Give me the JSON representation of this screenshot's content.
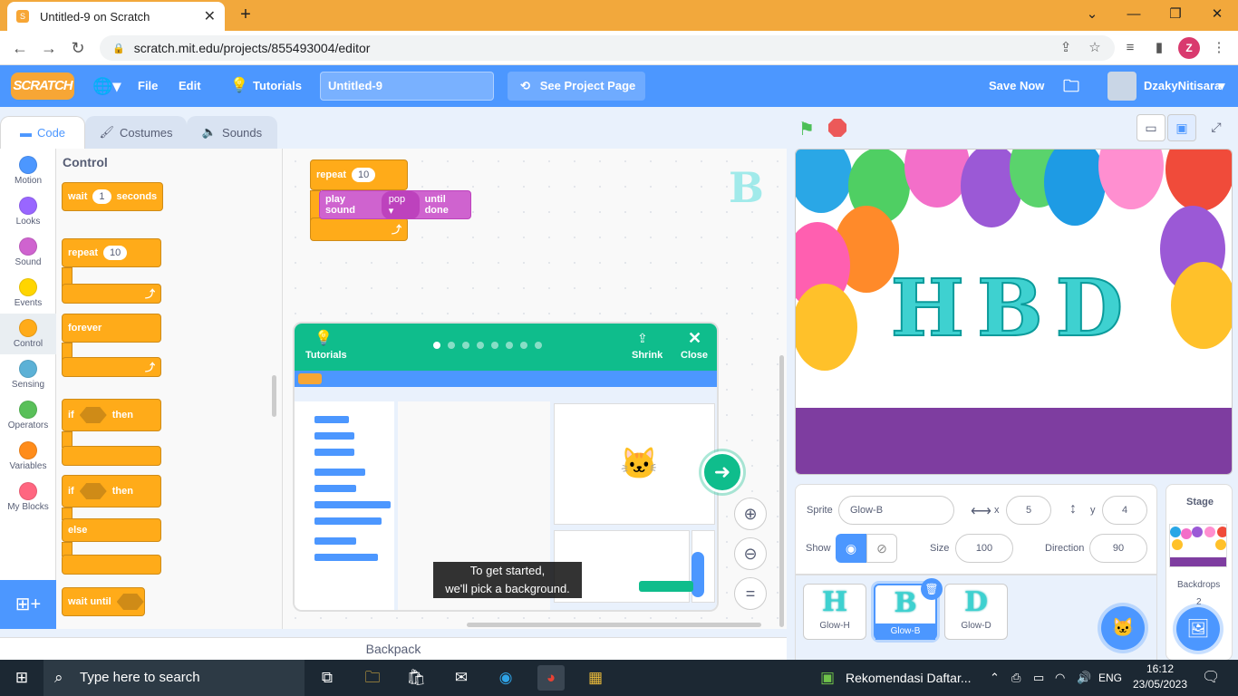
{
  "browser": {
    "tab_title": "Untitled-9 on Scratch",
    "url": "scratch.mit.edu/projects/855493004/editor",
    "profile_initial": "Z"
  },
  "menu": {
    "logo": "SCRATCH",
    "file": "File",
    "edit": "Edit",
    "tutorials": "Tutorials",
    "project_title": "Untitled-9",
    "see_project": "See Project Page",
    "save_now": "Save Now",
    "username": "DzakyNitisara"
  },
  "editor_tabs": {
    "code": "Code",
    "costumes": "Costumes",
    "sounds": "Sounds"
  },
  "categories": [
    {
      "label": "Motion",
      "color": "#4c97ff"
    },
    {
      "label": "Looks",
      "color": "#9966ff"
    },
    {
      "label": "Sound",
      "color": "#cf63cf"
    },
    {
      "label": "Events",
      "color": "#ffd500"
    },
    {
      "label": "Control",
      "color": "#ffab19"
    },
    {
      "label": "Sensing",
      "color": "#5cb1d6"
    },
    {
      "label": "Operators",
      "color": "#59c059"
    },
    {
      "label": "Variables",
      "color": "#ff8c1a"
    },
    {
      "label": "My Blocks",
      "color": "#ff6680"
    }
  ],
  "palette": {
    "title": "Control",
    "wait": "wait",
    "wait_val": "1",
    "seconds": "seconds",
    "repeat": "repeat",
    "repeat_val": "10",
    "forever": "forever",
    "if": "if",
    "then": "then",
    "else": "else",
    "wait_until": "wait until"
  },
  "script": {
    "repeat": "repeat",
    "repeat_val": "10",
    "play_sound": "play sound",
    "sound_name": "pop",
    "until_done": "until done",
    "sprite_letter": "B"
  },
  "tutorial": {
    "label": "Tutorials",
    "shrink": "Shrink",
    "close": "Close",
    "caption_line1": "To get started,",
    "caption_line2": "we'll pick a background.",
    "step_count": 8
  },
  "backpack": "Backpack",
  "stage": {
    "banner": "HBD"
  },
  "sprite_info": {
    "sprite_label": "Sprite",
    "sprite_name": "Glow-B",
    "x_label": "x",
    "x": "5",
    "y_label": "y",
    "y": "4",
    "show_label": "Show",
    "size_label": "Size",
    "size": "100",
    "direction_label": "Direction",
    "direction": "90"
  },
  "sprites": [
    {
      "name": "Glow-H",
      "glyph": "H"
    },
    {
      "name": "Glow-B",
      "glyph": "B",
      "selected": true
    },
    {
      "name": "Glow-D",
      "glyph": "D"
    }
  ],
  "stage_panel": {
    "title": "Stage",
    "backdrops_label": "Backdrops",
    "backdrops_count": "2"
  },
  "taskbar": {
    "search_placeholder": "Type here to search",
    "news": "Rekomendasi Daftar...",
    "lang": "ENG",
    "time": "16:12",
    "date": "23/05/2023"
  }
}
